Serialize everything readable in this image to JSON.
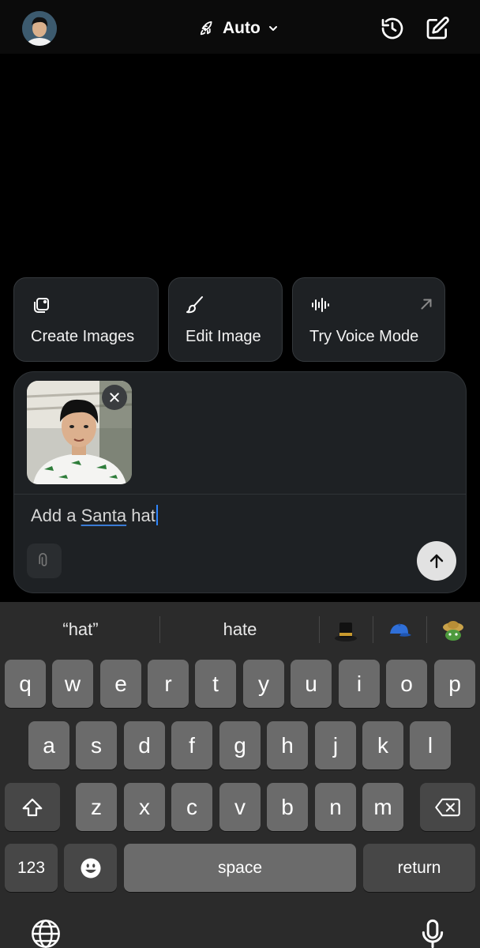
{
  "header": {
    "model_label": "Auto",
    "icons": [
      "rocket-icon",
      "chevron-down-icon",
      "history-icon",
      "new-chat-icon"
    ]
  },
  "suggestions": [
    {
      "label": "Create Images",
      "icon": "image-stack-icon"
    },
    {
      "label": "Edit Image",
      "icon": "brush-icon"
    },
    {
      "label": "Try Voice Mode",
      "icon": "waveform-icon",
      "trailing_icon": "arrow-up-right-icon"
    }
  ],
  "composer": {
    "prompt_plain_before": "Add a ",
    "prompt_underlined": "Santa",
    "prompt_plain_after": " hat",
    "attachment": "photo-thumbnail"
  },
  "keyboard": {
    "suggestions": [
      "“hat”",
      "hate"
    ],
    "emoji_suggestions": [
      "top-hat-emoji",
      "cap-emoji",
      "turtle-hat-emoji"
    ],
    "rows": [
      [
        "q",
        "w",
        "e",
        "r",
        "t",
        "y",
        "u",
        "i",
        "o",
        "p"
      ],
      [
        "a",
        "s",
        "d",
        "f",
        "g",
        "h",
        "j",
        "k",
        "l"
      ],
      [
        "z",
        "x",
        "c",
        "v",
        "b",
        "n",
        "m"
      ]
    ],
    "numbers_label": "123",
    "space_label": "space",
    "return_label": "return"
  },
  "colors": {
    "background": "#000000",
    "card": "#1e2124",
    "caret": "#2f86ff",
    "key": "#6b6b6b",
    "key_dark": "#474747"
  }
}
